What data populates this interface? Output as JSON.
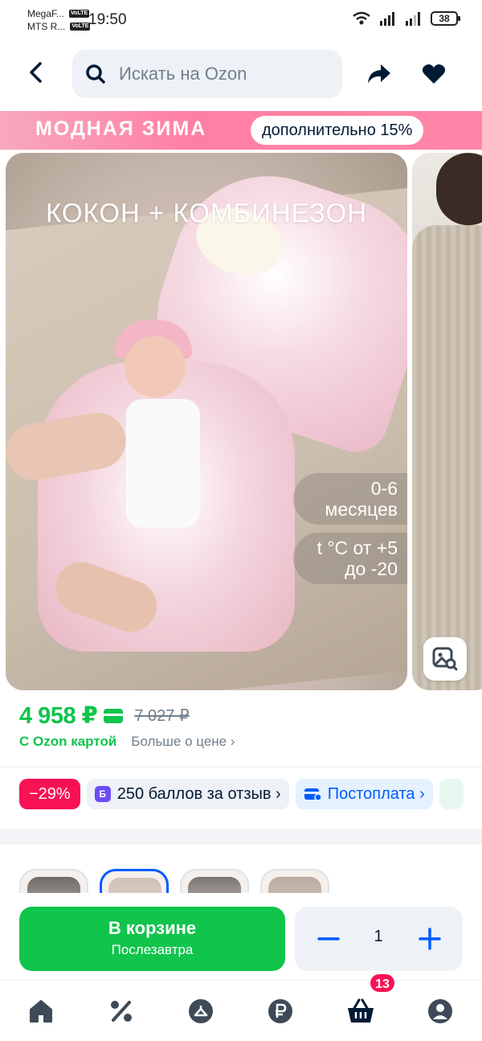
{
  "status_bar": {
    "carrier1": "MegaF...",
    "carrier2": "MTS R...",
    "volte": "VoLTE",
    "time": "19:50",
    "battery": "38",
    "icons": [
      "wifi-icon",
      "signal-icon",
      "signal-icon",
      "battery-icon"
    ]
  },
  "header": {
    "search_placeholder": "Искать на Ozon",
    "icons": [
      "back-arrow-icon",
      "search-icon",
      "share-icon",
      "heart-icon"
    ]
  },
  "banner": {
    "title": "МОДНАЯ ЗИМА",
    "pill": "дополнительно 15%"
  },
  "gallery": {
    "main_title": "КОКОН + КОМБИНЕЗОН",
    "tag_age": "0-6 месяцев",
    "tag_temp": "t °C от +5 до -20"
  },
  "price": {
    "current": "4 958 ₽",
    "old": "7 027 ₽",
    "ozon_card": "С Ozon картой",
    "more": "Больше о цене ›"
  },
  "chips": {
    "discount": "−29%",
    "points_badge": "Б",
    "points": "250 баллов за отзыв ›",
    "postpay": "Постоплата ›"
  },
  "cart": {
    "label": "В корзине",
    "sub": "Послезавтра",
    "quantity": "1"
  },
  "nav": {
    "items": [
      "home-icon",
      "percent-icon",
      "catalog-icon",
      "ruble-icon",
      "cart-icon",
      "profile-icon"
    ],
    "cart_count": "13"
  },
  "colors": {
    "accent_green": "#10c44c",
    "accent_blue": "#005bff",
    "accent_pink": "#f91155",
    "text": "#001a34"
  }
}
